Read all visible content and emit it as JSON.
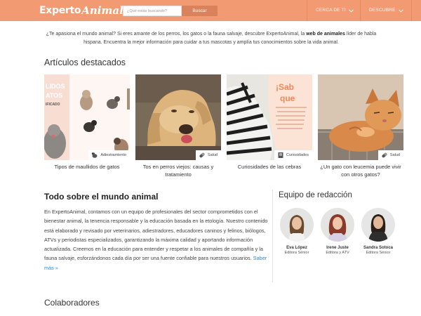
{
  "header": {
    "logo_part1": "Experto",
    "logo_part2": "Animal",
    "search_placeholder": "¿Qué estás buscando?",
    "search_button": "Buscar",
    "nav": [
      {
        "label": "CERCA DE TI"
      },
      {
        "label": "DESCUBRE"
      }
    ]
  },
  "intro": {
    "text_before": "¿Te apasiona el mundo animal? Si eres amante de los perros, los gatos o la fauna salvaje, descubre ExpertoAnimal, la ",
    "bold": "web de animales",
    "text_after": " líder de habla hispana. Encuentra la mejor información para cuidar a tus mascotas y amplía tus conocimientos sobre la vida animal."
  },
  "featured": {
    "title": "Artículos destacados",
    "cards": [
      {
        "category": "Adiestramiento",
        "caption": "Tipos de maullidos de gatos",
        "category_icon": "dog-icon",
        "image_text": [
          "LIDOS",
          "ATOS",
          "IFICADO"
        ]
      },
      {
        "category": "Salud",
        "caption": "Tos en perros viejos: causas y tratamiento",
        "category_icon": "pill-icon"
      },
      {
        "category": "Curiosidades",
        "caption": "Curiosidades de las cebras",
        "category_icon": "book-icon",
        "image_text": [
          "¡Sab",
          "que"
        ]
      },
      {
        "category": "Salud",
        "caption": "¿Un gato con leucemia puede vivir con otros gatos?",
        "category_icon": "pill-icon"
      }
    ]
  },
  "about": {
    "title": "Todo sobre el mundo animal",
    "text": "En ExpertoAnimal, contamos con un equipo de profesionales del sector comprometidos con el bienestar animal, la tenencia responsable y la educación basada en la etología. Nuestro contenido está elaborado y revisado por veterinarios, adiestradores, educadores caninos y felinos, biólogos, ATVs y periodistas especializados, garantizando la máxima calidad y aportando información actualizada. Creemos en la educación para entender y respetar a los animales de compañía y la fauna salvaje, esforzándonos cada día por ser una fuente confiable para nuestros usuarios. ",
    "link": "Saber más »"
  },
  "team": {
    "title": "Equipo de redacción",
    "members": [
      {
        "name": "Eva López",
        "role": "Editora Sénior"
      },
      {
        "name": "Irene Juste",
        "role": "Editora y ATV"
      },
      {
        "name": "Sandra Sotoca",
        "role": "Editora Sénior"
      }
    ]
  },
  "collaborators": {
    "title": "Colaboradores"
  },
  "colors": {
    "brand": "#f29a72",
    "button": "#d9825c",
    "link": "#2e8bd6"
  }
}
